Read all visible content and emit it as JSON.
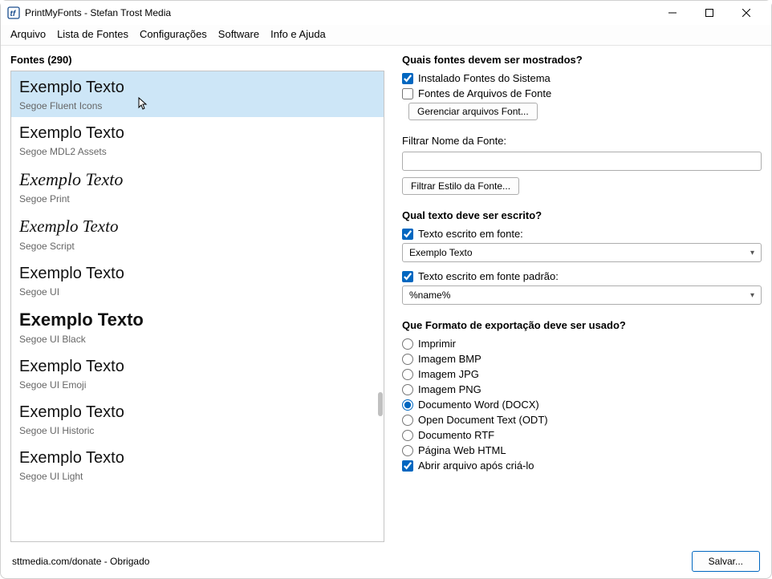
{
  "titlebar": {
    "title": "PrintMyFonts - Stefan Trost Media"
  },
  "menu": {
    "items": [
      "Arquivo",
      "Lista de Fontes",
      "Configurações",
      "Software",
      "Info e Ajuda"
    ]
  },
  "fontlist": {
    "header": "Fontes (290)",
    "items": [
      {
        "sample": "Exemplo Texto",
        "name": "Segoe Fluent Icons",
        "cls": "fluent",
        "selected": true
      },
      {
        "sample": "Exemplo Texto",
        "name": "Segoe MDL2 Assets",
        "cls": "mdl2"
      },
      {
        "sample": "Exemplo Texto",
        "name": "Segoe Print",
        "cls": "print"
      },
      {
        "sample": "Exemplo Texto",
        "name": "Segoe Script",
        "cls": "script"
      },
      {
        "sample": "Exemplo Texto",
        "name": "Segoe UI",
        "cls": "segoeui"
      },
      {
        "sample": "Exemplo Texto",
        "name": "Segoe UI Black",
        "cls": "black"
      },
      {
        "sample": "Exemplo Texto",
        "name": "Segoe UI Emoji",
        "cls": "emoji"
      },
      {
        "sample": "Exemplo Texto",
        "name": "Segoe UI Historic",
        "cls": "historic"
      },
      {
        "sample": "Exemplo Texto",
        "name": "Segoe UI Light",
        "cls": "light"
      }
    ]
  },
  "right": {
    "display": {
      "title": "Quais fontes devem ser mostrados?",
      "system": "Instalado Fontes do Sistema",
      "files": "Fontes de Arquivos de Fonte",
      "manage": "Gerenciar arquivos Font..."
    },
    "filter": {
      "name_label": "Filtrar Nome da Fonte:",
      "value": "",
      "style_btn": "Filtrar Estilo da Fonte..."
    },
    "text": {
      "title": "Qual texto deve ser escrito?",
      "infont": "Texto escrito em fonte:",
      "sample_value": "Exemplo Texto",
      "default": "Texto escrito em fonte padrão:",
      "default_value": "%name%"
    },
    "export": {
      "title": "Que Formato de exportação deve ser usado?",
      "print": "Imprimir",
      "bmp": "Imagem BMP",
      "jpg": "Imagem JPG",
      "png": "Imagem PNG",
      "docx": "Documento Word (DOCX)",
      "odt": "Open Document Text (ODT)",
      "rtf": "Documento RTF",
      "html": "Página Web HTML",
      "openafter": "Abrir arquivo após criá-lo"
    }
  },
  "status": {
    "text": "sttmedia.com/donate - Obrigado",
    "save": "Salvar..."
  }
}
